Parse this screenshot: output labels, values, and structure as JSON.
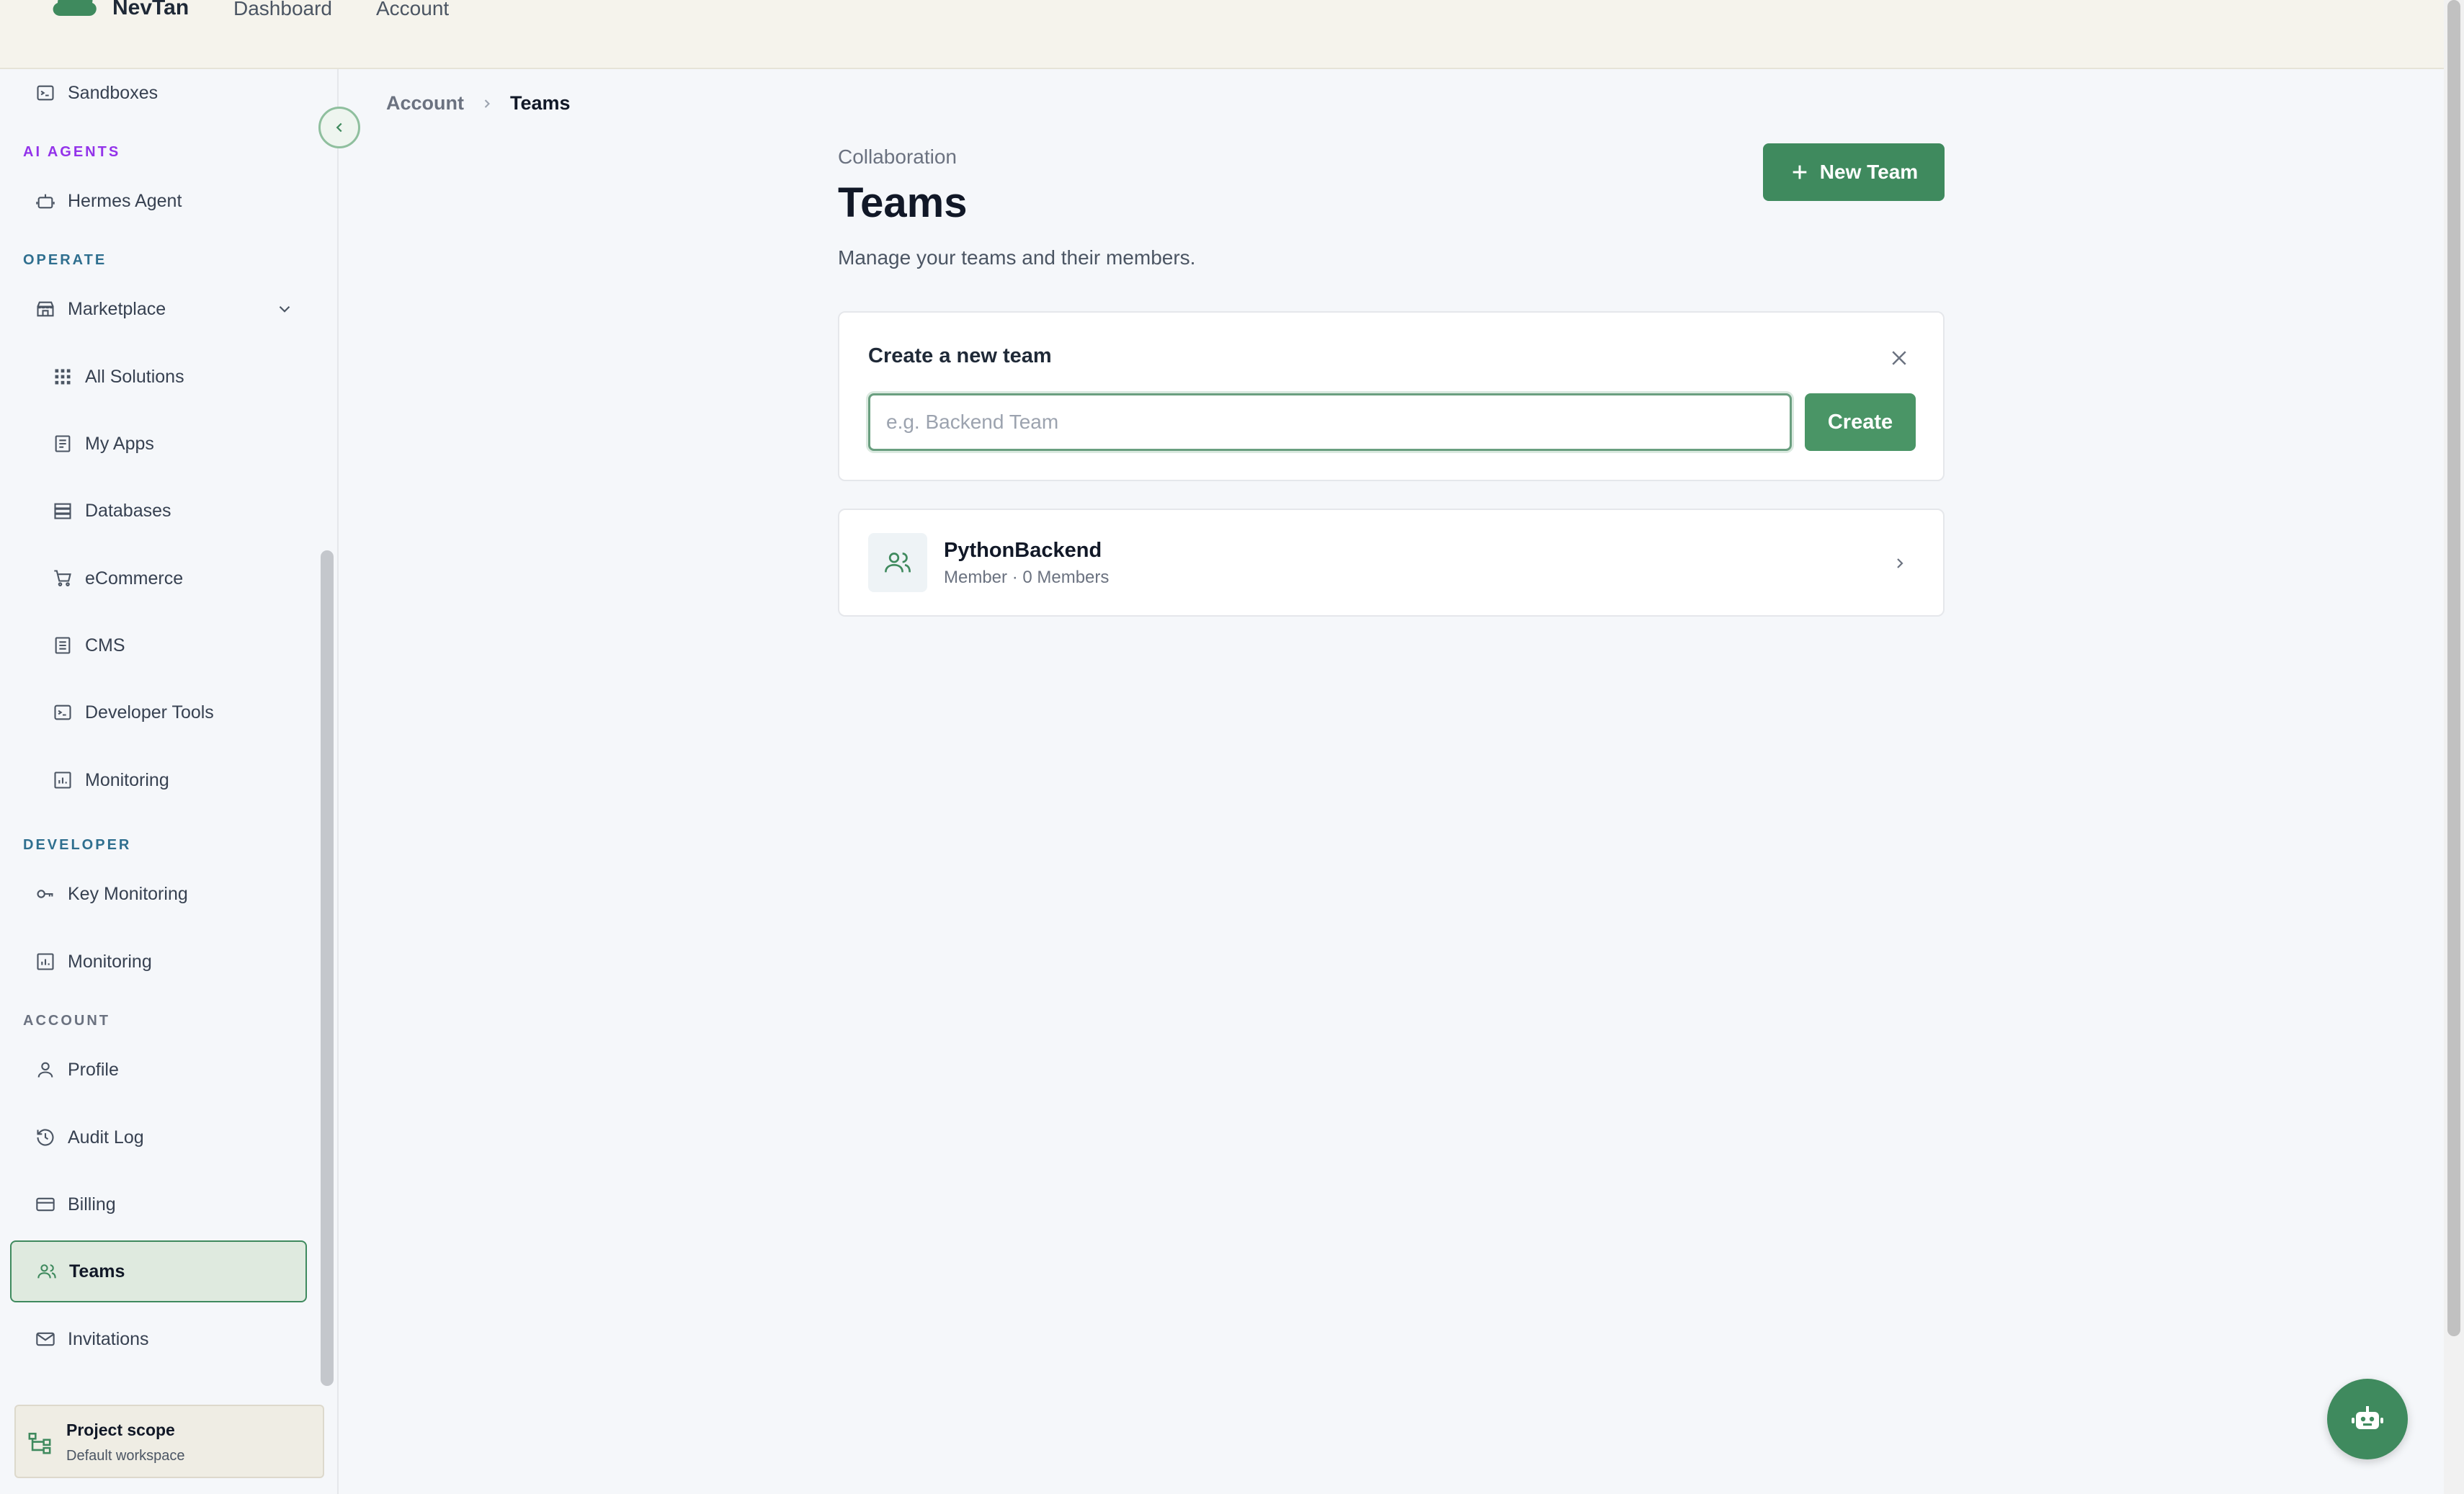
{
  "app": {
    "brand": "NevTan"
  },
  "topnav": {
    "dashboard": "Dashboard",
    "account": "Account"
  },
  "sidebar": {
    "items_top": [
      {
        "label": "Sandboxes",
        "icon": "terminal-icon"
      }
    ],
    "sections": {
      "ai_agents": "AI AGENTS",
      "operate": "OPERATE",
      "developer": "DEVELOPER",
      "account": "ACCOUNT"
    },
    "ai_agents": [
      {
        "label": "Hermes Agent",
        "icon": "robot-icon"
      }
    ],
    "marketplace": {
      "label": "Marketplace",
      "icon": "store-icon",
      "expanded": true
    },
    "marketplace_items": [
      {
        "label": "All Solutions",
        "icon": "grid-icon"
      },
      {
        "label": "My Apps",
        "icon": "list-icon"
      },
      {
        "label": "Databases",
        "icon": "database-icon"
      },
      {
        "label": "eCommerce",
        "icon": "cart-icon"
      },
      {
        "label": "CMS",
        "icon": "document-icon"
      },
      {
        "label": "Developer Tools",
        "icon": "terminal-icon"
      },
      {
        "label": "Monitoring",
        "icon": "chart-icon"
      }
    ],
    "developer": [
      {
        "label": "Key Monitoring",
        "icon": "key-icon"
      },
      {
        "label": "Monitoring",
        "icon": "chart-icon"
      }
    ],
    "account": [
      {
        "label": "Profile",
        "icon": "user-icon"
      },
      {
        "label": "Audit Log",
        "icon": "history-icon"
      },
      {
        "label": "Billing",
        "icon": "credit-card-icon"
      },
      {
        "label": "Teams",
        "icon": "users-icon",
        "active": true
      },
      {
        "label": "Invitations",
        "icon": "mail-icon"
      }
    ],
    "project_scope": {
      "title": "Project scope",
      "subtitle": "Default workspace"
    }
  },
  "breadcrumb": {
    "parent": "Account",
    "current": "Teams"
  },
  "header": {
    "eyebrow": "Collaboration",
    "title": "Teams",
    "subtitle": "Manage your teams and their members.",
    "new_team_label": "New Team"
  },
  "create_form": {
    "title": "Create a new team",
    "input_value": "",
    "input_placeholder": "e.g. Backend Team",
    "create_label": "Create"
  },
  "teams": [
    {
      "name": "PythonBackend",
      "meta": "Member · 0 Members"
    }
  ],
  "colors": {
    "accent": "#3f8a5e",
    "ai_agents_label": "#9333ea",
    "section_label": "#2f6f8f"
  }
}
